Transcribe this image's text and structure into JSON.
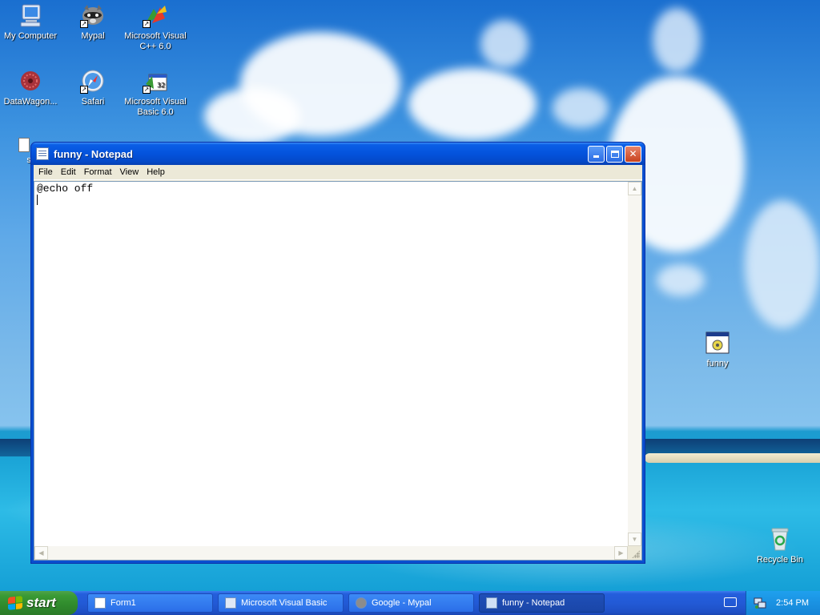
{
  "desktop": {
    "icons": [
      {
        "label": "My Computer",
        "icon": "my-computer-icon"
      },
      {
        "label": "Mypal",
        "icon": "mypal-raccoon-icon"
      },
      {
        "label": "Microsoft Visual C++ 6.0",
        "icon": "visual-cpp-icon"
      },
      {
        "label": "DataWagon...",
        "icon": "datawagon-icon"
      },
      {
        "label": "Safari",
        "icon": "safari-compass-icon"
      },
      {
        "label": "Microsoft Visual Basic 6.0",
        "icon": "visual-basic-icon"
      },
      {
        "label": "se",
        "icon": "document-icon"
      },
      {
        "label": "funny",
        "icon": "batch-file-icon"
      },
      {
        "label": "Recycle Bin",
        "icon": "recycle-bin-icon"
      }
    ]
  },
  "notepad": {
    "title": "funny - Notepad",
    "menu": [
      "File",
      "Edit",
      "Format",
      "View",
      "Help"
    ],
    "content": "@echo off",
    "title_buttons": {
      "minimize": "minimize-icon",
      "maximize": "maximize-icon",
      "close": "close-icon"
    }
  },
  "taskbar": {
    "start_label": "start",
    "tasks": [
      {
        "label": "Form1",
        "icon": "form-icon"
      },
      {
        "label": "Microsoft Visual Basic",
        "icon": "visual-basic-icon"
      },
      {
        "label": "Google - Mypal",
        "icon": "mypal-raccoon-icon"
      },
      {
        "label": "funny - Notepad",
        "icon": "notepad-icon"
      }
    ],
    "clock": "2:54 PM"
  },
  "colors": {
    "xp_blue": "#0453dc",
    "start_green": "#3a9a35",
    "tray_blue": "#1584d6"
  }
}
